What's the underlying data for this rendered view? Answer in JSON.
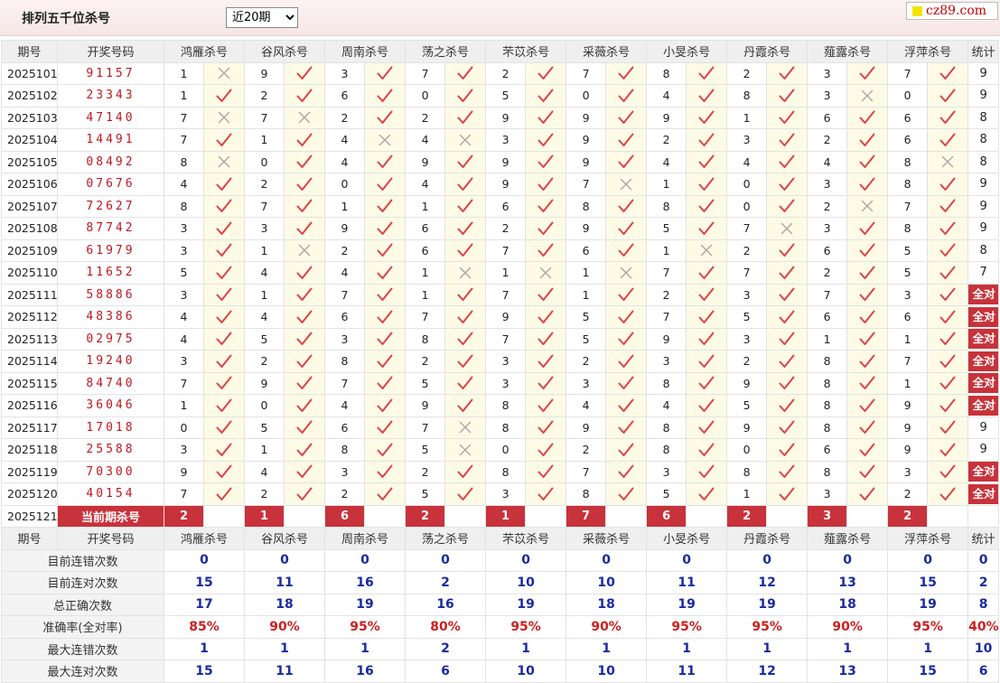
{
  "page": {
    "title": "排列五千位杀号",
    "period_select": {
      "selected": "近20期",
      "options": [
        "近20期"
      ]
    },
    "brand": "cz89.com"
  },
  "colors": {
    "accent_red": "#c8323a",
    "number_red": "#c0161f",
    "stat_blue": "#1a2aa0",
    "check_red": "#e0404a",
    "cross_gray": "#aaaaaa",
    "mark_bg": "#fdfbe6"
  },
  "headers": {
    "period": "期号",
    "numbers": "开奖号码",
    "experts": [
      "鸿雁杀号",
      "谷风杀号",
      "周南杀号",
      "荡之杀号",
      "芣苡杀号",
      "采薇杀号",
      "小旻杀号",
      "丹霞杀号",
      "薤露杀号",
      "浮萍杀号"
    ],
    "stats": "统计"
  },
  "rows": [
    {
      "period": "2025101",
      "numbers": "91157",
      "kills": [
        1,
        9,
        3,
        7,
        2,
        7,
        8,
        2,
        3,
        7
      ],
      "hits": [
        0,
        1,
        1,
        1,
        1,
        1,
        1,
        1,
        1,
        1
      ],
      "stat": "9"
    },
    {
      "period": "2025102",
      "numbers": "23343",
      "kills": [
        1,
        2,
        6,
        0,
        5,
        0,
        4,
        8,
        3,
        0
      ],
      "hits": [
        1,
        1,
        1,
        1,
        1,
        1,
        1,
        1,
        0,
        1
      ],
      "stat": "9"
    },
    {
      "period": "2025103",
      "numbers": "47140",
      "kills": [
        7,
        7,
        2,
        2,
        9,
        9,
        9,
        1,
        6,
        6
      ],
      "hits": [
        0,
        0,
        1,
        1,
        1,
        1,
        1,
        1,
        1,
        1
      ],
      "stat": "8"
    },
    {
      "period": "2025104",
      "numbers": "14491",
      "kills": [
        7,
        1,
        4,
        4,
        3,
        9,
        2,
        3,
        2,
        6
      ],
      "hits": [
        1,
        1,
        0,
        0,
        1,
        1,
        1,
        1,
        1,
        1
      ],
      "stat": "8"
    },
    {
      "period": "2025105",
      "numbers": "08492",
      "kills": [
        8,
        0,
        4,
        9,
        9,
        9,
        4,
        4,
        4,
        8
      ],
      "hits": [
        0,
        1,
        1,
        1,
        1,
        1,
        1,
        1,
        1,
        0
      ],
      "stat": "8"
    },
    {
      "period": "2025106",
      "numbers": "07676",
      "kills": [
        4,
        2,
        0,
        4,
        9,
        7,
        1,
        0,
        3,
        8
      ],
      "hits": [
        1,
        1,
        1,
        1,
        1,
        0,
        1,
        1,
        1,
        1
      ],
      "stat": "9"
    },
    {
      "period": "2025107",
      "numbers": "72627",
      "kills": [
        8,
        7,
        1,
        1,
        6,
        8,
        8,
        0,
        2,
        7
      ],
      "hits": [
        1,
        1,
        1,
        1,
        1,
        1,
        1,
        1,
        0,
        1
      ],
      "stat": "9"
    },
    {
      "period": "2025108",
      "numbers": "87742",
      "kills": [
        3,
        3,
        9,
        6,
        2,
        9,
        5,
        7,
        3,
        8
      ],
      "hits": [
        1,
        1,
        1,
        1,
        1,
        1,
        1,
        0,
        1,
        1
      ],
      "stat": "9"
    },
    {
      "period": "2025109",
      "numbers": "61979",
      "kills": [
        3,
        1,
        2,
        6,
        7,
        6,
        1,
        2,
        6,
        5
      ],
      "hits": [
        1,
        0,
        1,
        1,
        1,
        1,
        0,
        1,
        1,
        1
      ],
      "stat": "8"
    },
    {
      "period": "2025110",
      "numbers": "11652",
      "kills": [
        5,
        4,
        4,
        1,
        1,
        1,
        7,
        7,
        2,
        5
      ],
      "hits": [
        1,
        1,
        1,
        0,
        0,
        0,
        1,
        1,
        1,
        1
      ],
      "stat": "7"
    },
    {
      "period": "2025111",
      "numbers": "58886",
      "kills": [
        3,
        1,
        7,
        1,
        7,
        1,
        2,
        3,
        7,
        3
      ],
      "hits": [
        1,
        1,
        1,
        1,
        1,
        1,
        1,
        1,
        1,
        1
      ],
      "stat": "全对"
    },
    {
      "period": "2025112",
      "numbers": "48386",
      "kills": [
        4,
        4,
        6,
        7,
        9,
        5,
        7,
        5,
        6,
        6
      ],
      "hits": [
        1,
        1,
        1,
        1,
        1,
        1,
        1,
        1,
        1,
        1
      ],
      "stat": "全对"
    },
    {
      "period": "2025113",
      "numbers": "02975",
      "kills": [
        4,
        5,
        3,
        8,
        7,
        5,
        9,
        3,
        1,
        1
      ],
      "hits": [
        1,
        1,
        1,
        1,
        1,
        1,
        1,
        1,
        1,
        1
      ],
      "stat": "全对"
    },
    {
      "period": "2025114",
      "numbers": "19240",
      "kills": [
        3,
        2,
        8,
        2,
        3,
        2,
        3,
        2,
        8,
        7
      ],
      "hits": [
        1,
        1,
        1,
        1,
        1,
        1,
        1,
        1,
        1,
        1
      ],
      "stat": "全对"
    },
    {
      "period": "2025115",
      "numbers": "84740",
      "kills": [
        7,
        9,
        7,
        5,
        3,
        3,
        8,
        9,
        8,
        1
      ],
      "hits": [
        1,
        1,
        1,
        1,
        1,
        1,
        1,
        1,
        1,
        1
      ],
      "stat": "全对"
    },
    {
      "period": "2025116",
      "numbers": "36046",
      "kills": [
        1,
        0,
        4,
        9,
        8,
        4,
        4,
        5,
        8,
        9
      ],
      "hits": [
        1,
        1,
        1,
        1,
        1,
        1,
        1,
        1,
        1,
        1
      ],
      "stat": "全对"
    },
    {
      "period": "2025117",
      "numbers": "17018",
      "kills": [
        0,
        5,
        6,
        7,
        8,
        9,
        8,
        9,
        8,
        9
      ],
      "hits": [
        1,
        1,
        1,
        0,
        1,
        1,
        1,
        1,
        1,
        1
      ],
      "stat": "9"
    },
    {
      "period": "2025118",
      "numbers": "25588",
      "kills": [
        3,
        1,
        8,
        5,
        0,
        2,
        8,
        0,
        6,
        9
      ],
      "hits": [
        1,
        1,
        1,
        0,
        1,
        1,
        1,
        1,
        1,
        1
      ],
      "stat": "9"
    },
    {
      "period": "2025119",
      "numbers": "70300",
      "kills": [
        9,
        4,
        3,
        2,
        8,
        7,
        3,
        8,
        8,
        3
      ],
      "hits": [
        1,
        1,
        1,
        1,
        1,
        1,
        1,
        1,
        1,
        1
      ],
      "stat": "全对"
    },
    {
      "period": "2025120",
      "numbers": "40154",
      "kills": [
        7,
        2,
        2,
        5,
        3,
        8,
        5,
        1,
        3,
        2
      ],
      "hits": [
        1,
        1,
        1,
        1,
        1,
        1,
        1,
        1,
        1,
        1
      ],
      "stat": "全对"
    }
  ],
  "current": {
    "period": "2025121",
    "label": "当前期杀号",
    "kills": [
      "2",
      "1",
      "6",
      "2",
      "1",
      "7",
      "6",
      "2",
      "3",
      "2"
    ]
  },
  "summary": [
    {
      "label": "目前连错次数",
      "values": [
        "0",
        "0",
        "0",
        "0",
        "0",
        "0",
        "0",
        "0",
        "0",
        "0"
      ],
      "total": "0"
    },
    {
      "label": "目前连对次数",
      "values": [
        "15",
        "11",
        "16",
        "2",
        "10",
        "10",
        "11",
        "12",
        "13",
        "15"
      ],
      "total": "2"
    },
    {
      "label": "总正确次数",
      "values": [
        "17",
        "18",
        "19",
        "16",
        "19",
        "18",
        "19",
        "19",
        "18",
        "19"
      ],
      "total": "8"
    },
    {
      "label": "准确率(全对率)",
      "values": [
        "85%",
        "90%",
        "95%",
        "80%",
        "95%",
        "90%",
        "95%",
        "95%",
        "90%",
        "95%"
      ],
      "total": "40%"
    },
    {
      "label": "最大连错次数",
      "values": [
        "1",
        "1",
        "1",
        "2",
        "1",
        "1",
        "1",
        "1",
        "1",
        "1"
      ],
      "total": "10"
    },
    {
      "label": "最大连对次数",
      "values": [
        "15",
        "11",
        "16",
        "6",
        "10",
        "10",
        "11",
        "12",
        "13",
        "15"
      ],
      "total": "6"
    }
  ]
}
